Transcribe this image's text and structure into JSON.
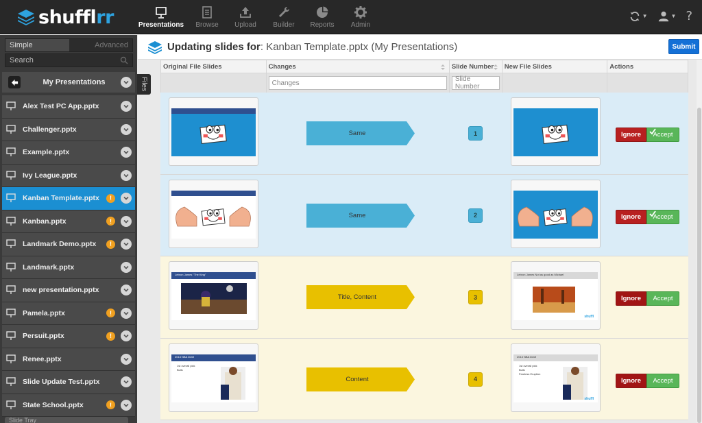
{
  "app": {
    "logo_text": "shuffl",
    "logo_accent": "rr"
  },
  "nav": [
    {
      "label": "Presentations",
      "icon": "presentation-icon",
      "active": true
    },
    {
      "label": "Browse",
      "icon": "browse-icon"
    },
    {
      "label": "Upload",
      "icon": "upload-icon"
    },
    {
      "label": "Builder",
      "icon": "wrench-icon"
    },
    {
      "label": "Reports",
      "icon": "pie-chart-icon"
    },
    {
      "label": "Admin",
      "icon": "gear-icon"
    }
  ],
  "top_right": {
    "help": "?"
  },
  "sidebar": {
    "mode_simple": "Simple",
    "mode_advanced": "Advanced",
    "search_placeholder": "Search",
    "my_presentations": "My Presentations",
    "files_tab": "Files",
    "bottom_label": "Slide Tray",
    "files": [
      {
        "name": "Alex Test PC App.pptx",
        "warn": false
      },
      {
        "name": "Challenger.pptx",
        "warn": false
      },
      {
        "name": "Example.pptx",
        "warn": false
      },
      {
        "name": "Ivy League.pptx",
        "warn": false
      },
      {
        "name": "Kanban Template.pptx",
        "warn": true,
        "active": true
      },
      {
        "name": "Kanban.pptx",
        "warn": true
      },
      {
        "name": "Landmark Demo.pptx",
        "warn": true
      },
      {
        "name": "Landmark.pptx",
        "warn": false
      },
      {
        "name": "new presentation.pptx",
        "warn": false
      },
      {
        "name": "Pamela.pptx",
        "warn": true
      },
      {
        "name": "Persuit.pptx",
        "warn": true
      },
      {
        "name": "Renee.pptx",
        "warn": false
      },
      {
        "name": "Slide Update Test.pptx",
        "warn": false
      },
      {
        "name": "State School.pptx",
        "warn": true
      }
    ],
    "warn_symbol": "!"
  },
  "header": {
    "title_prefix": "Updating slides for",
    "title_colon": ":",
    "title_file": " Kanban Template.pptx (My Presentations)",
    "submit_label": "Submit"
  },
  "table": {
    "columns": {
      "original": "Original File Slides",
      "changes": "Changes",
      "slide_number": "Slide Number",
      "new": "New File Slides",
      "actions": "Actions"
    },
    "filters": {
      "changes_placeholder": "Changes",
      "slide_number_placeholder": "Slide Number"
    },
    "ignore_label": "Ignore",
    "accept_label": "Accept",
    "rows": [
      {
        "change": "Same",
        "number": "1",
        "status": "same",
        "orig_slide_title": "",
        "new_slide_title": ""
      },
      {
        "change": "Same",
        "number": "2",
        "status": "same",
        "orig_slide_title": "",
        "new_slide_title": ""
      },
      {
        "change": "Title, Content",
        "number": "3",
        "status": "diff",
        "orig_slide_title": "Lebron James \"The King\"",
        "new_slide_title": "Lebron James Not as good as Michael"
      },
      {
        "change": "Content",
        "number": "4",
        "status": "diff",
        "orig_slide_title": "2013 NBA Draft",
        "new_slide_title": "2013 NBA Draft"
      }
    ],
    "slide4_bullets_orig": [
      "1st overall pick",
      "Bulls"
    ],
    "slide4_bullets_new": [
      "1st overall pick",
      "Bulls",
      "Fearless Eruption"
    ],
    "slide_watermark": "shuffl"
  },
  "colors": {
    "accent": "#1b8fd2",
    "same_row": "#daecf7",
    "diff_row": "#fbf6df",
    "same_ribbon": "#4ab0d6",
    "diff_ribbon": "#e8c000",
    "ignore": "#b82020",
    "accept": "#59b659"
  }
}
